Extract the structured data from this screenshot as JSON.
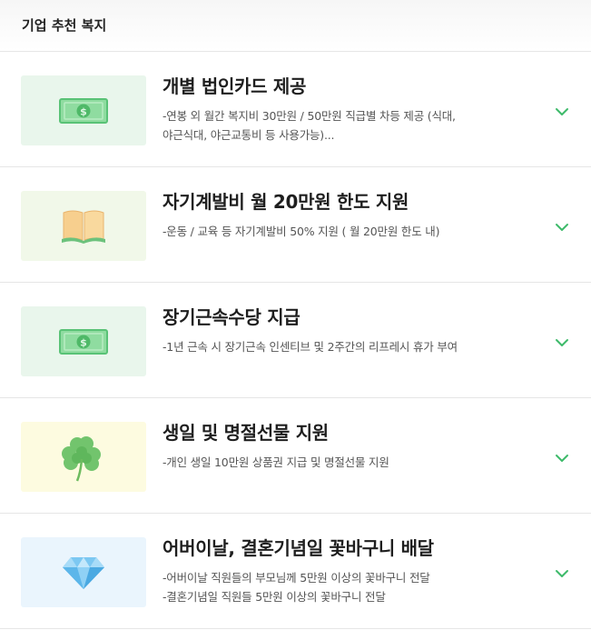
{
  "header": {
    "title": "기업 추천 복지"
  },
  "items": [
    {
      "icon": "money-icon",
      "bg": "#e9f6ec",
      "title": "개별 법인카드 제공",
      "desc": [
        "-연봉 외 월간 복지비 30만원 / 50만원 직급별 차등 제공 (식대,",
        "야근식대, 야근교통비 등 사용가능)..."
      ]
    },
    {
      "icon": "book-icon",
      "bg": "#f1f8e9",
      "title": "자기계발비 월 20만원 한도 지원",
      "desc": [
        "-운동 / 교육 등 자기계발비 50% 지원 ( 월 20만원 한도 내)"
      ]
    },
    {
      "icon": "money-icon",
      "bg": "#e9f6ec",
      "title": "장기근속수당 지급",
      "desc": [
        "-1년 근속 시 장기근속 인센티브 및 2주간의 리프레시 휴가 부여"
      ]
    },
    {
      "icon": "clover-icon",
      "bg": "#fdfbe0",
      "title": "생일 및 명절선물 지원",
      "desc": [
        "-개인 생일 10만원 상품권 지급 및 명절선물 지원"
      ]
    },
    {
      "icon": "diamond-icon",
      "bg": "#eaf5fd",
      "title": "어버이날, 결혼기념일 꽃바구니 배달",
      "desc": [
        "-어버이날 직원들의 부모님께 5만원 이상의 꽃바구니 전달",
        "-결혼기념일 직원들 5만원 이상의 꽃바구니 전달"
      ]
    }
  ],
  "accent": "#3dba6a"
}
